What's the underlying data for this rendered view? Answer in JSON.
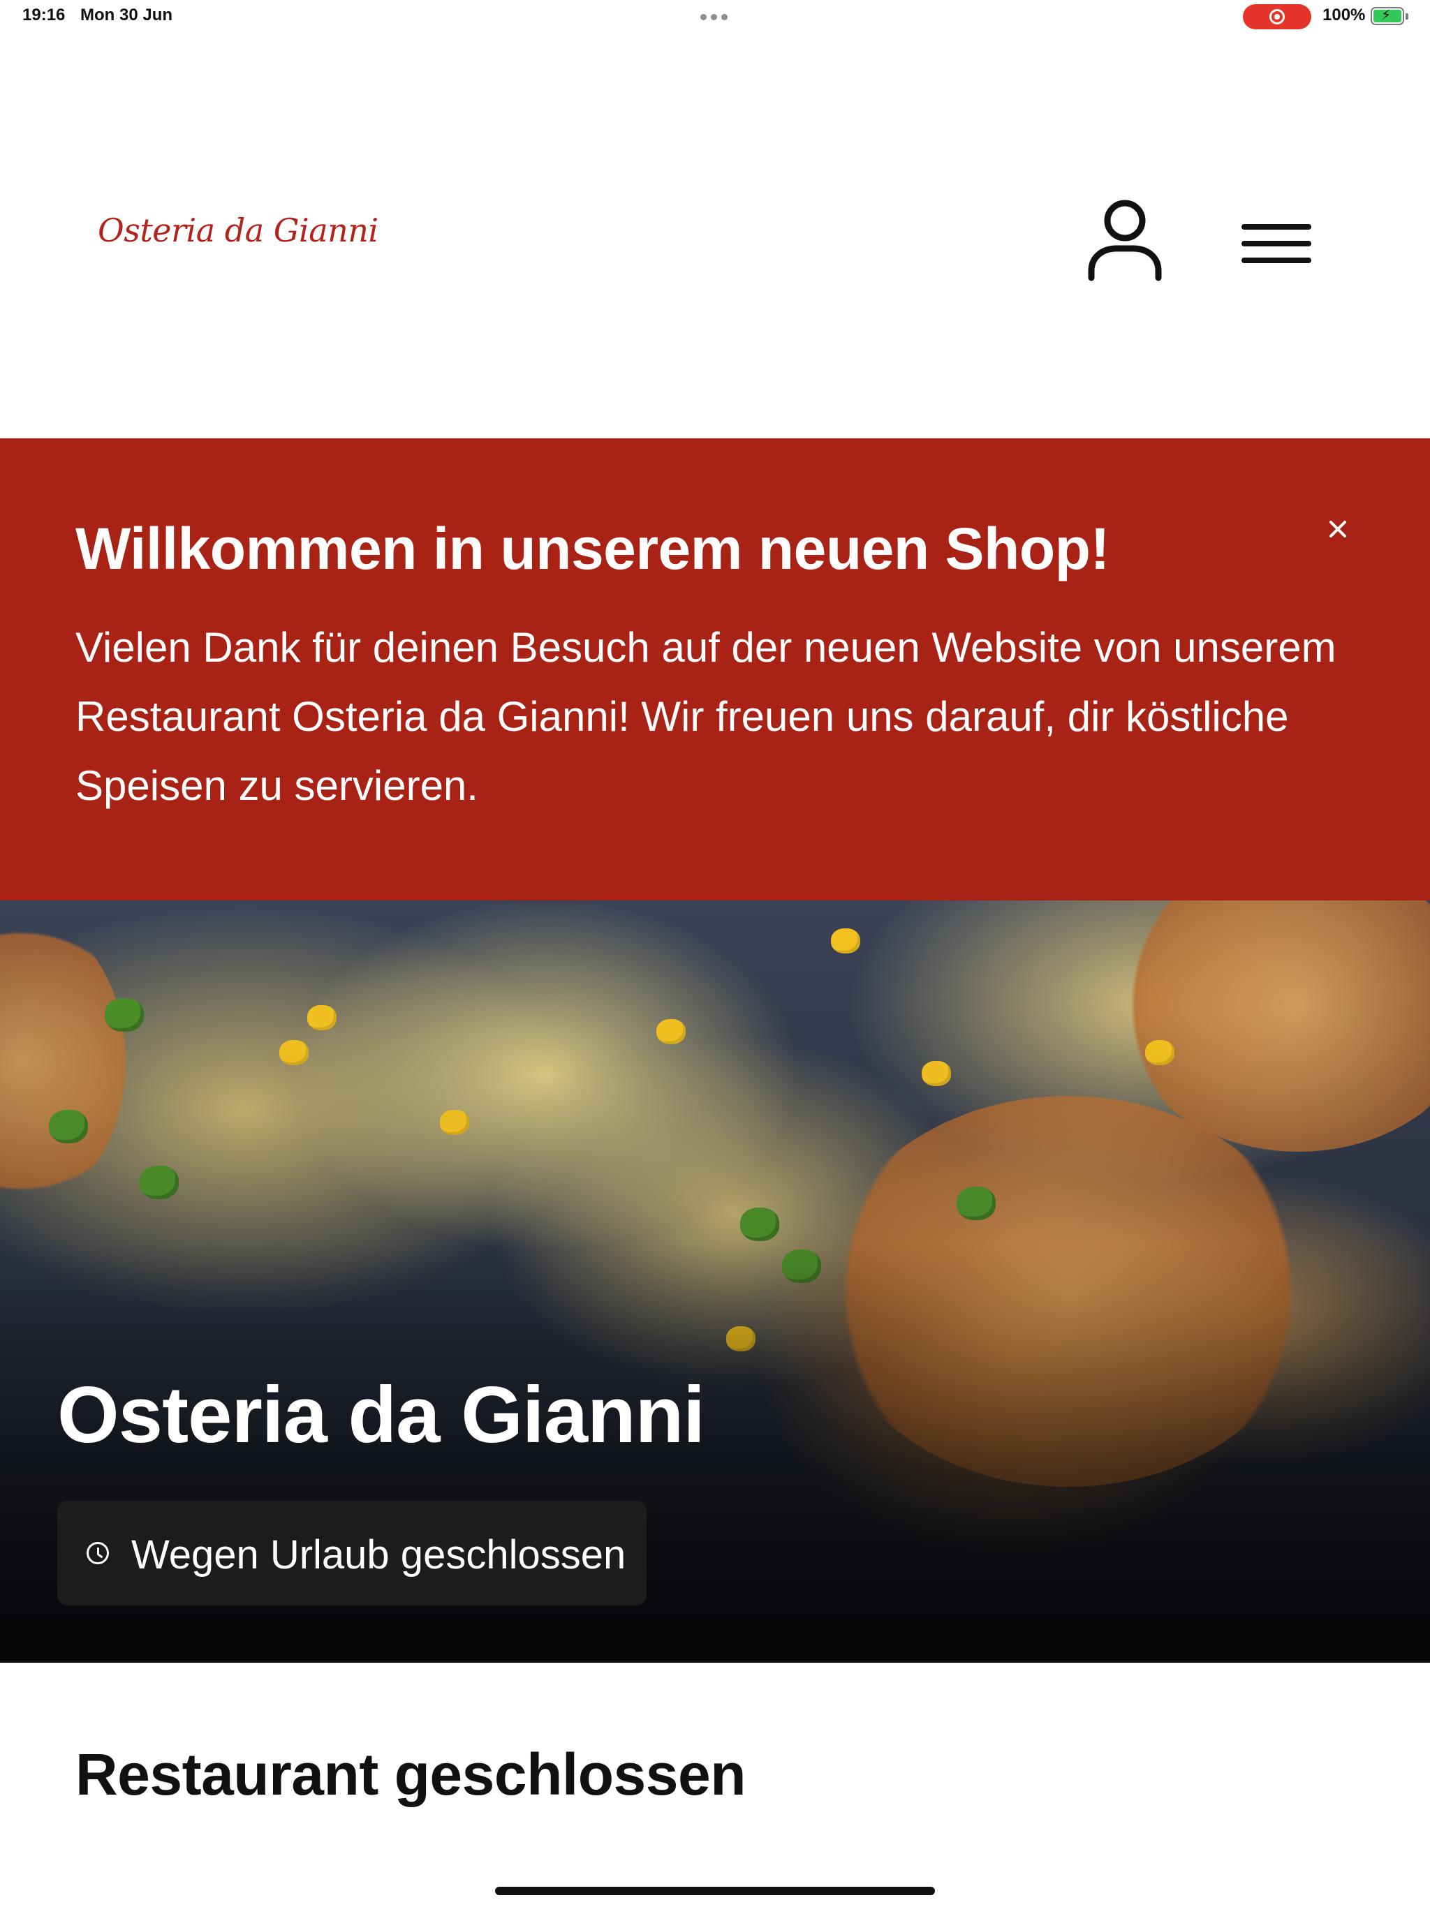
{
  "status_bar": {
    "time": "19:16",
    "date": "Mon 30 Jun",
    "battery_percent": "100%",
    "battery_level": 1.0,
    "recording_active": true
  },
  "header": {
    "logo_text": "Osteria da Gianni",
    "account_icon": "user-icon",
    "menu_icon": "hamburger-menu-icon"
  },
  "banner": {
    "title": "Willkommen in unserem neuen Shop!",
    "text": "Vielen Dank für deinen Besuch auf der neuen Website von unserem Restaurant Osteria da Gianni! Wir freuen uns darauf, dir köstliche Speisen zu servieren.",
    "close_icon": "close-icon",
    "background_color": "#a82215"
  },
  "hero": {
    "restaurant_name": "Osteria da Gianni",
    "status_label": "Wegen Urlaub geschlossen",
    "status_icon": "clock-icon"
  },
  "main": {
    "section_title": "Restaurant geschlossen"
  }
}
